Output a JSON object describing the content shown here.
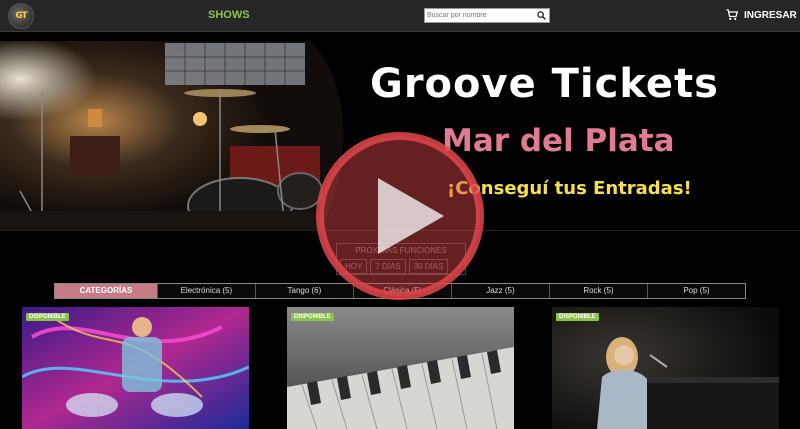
{
  "header": {
    "logo_text": "GT",
    "nav_shows": "SHOWS",
    "search_placeholder": "Buscar por nombre",
    "login_label": "INGRESAR"
  },
  "hero": {
    "title": "Groove Tickets",
    "subtitle": "Mar del Plata",
    "cta": "¡Conseguí tus Entradas!"
  },
  "filter": {
    "label": "PRÓXIMAS FUNCIONES",
    "options": [
      "HOY",
      "7 DÍAS",
      "30 DÍAS"
    ]
  },
  "categories": [
    "CATEGORÍAS",
    "Electrónica (5)",
    "Tango (6)",
    "Clásica (5)",
    "Jazz (5)",
    "Rock (5)",
    "Pop (5)"
  ],
  "cards": [
    {
      "badge": "DISPONIBLE",
      "image": "dj-neon-performer"
    },
    {
      "badge": "DISPONIBLE",
      "image": "piano-keys"
    },
    {
      "badge": "DISPONIBLE",
      "image": "singer-at-piano"
    }
  ],
  "colors": {
    "accent_green": "#8bc34a",
    "accent_pink": "#e07b92",
    "accent_yellow": "#f4e04d",
    "play_red": "#e0474c"
  }
}
